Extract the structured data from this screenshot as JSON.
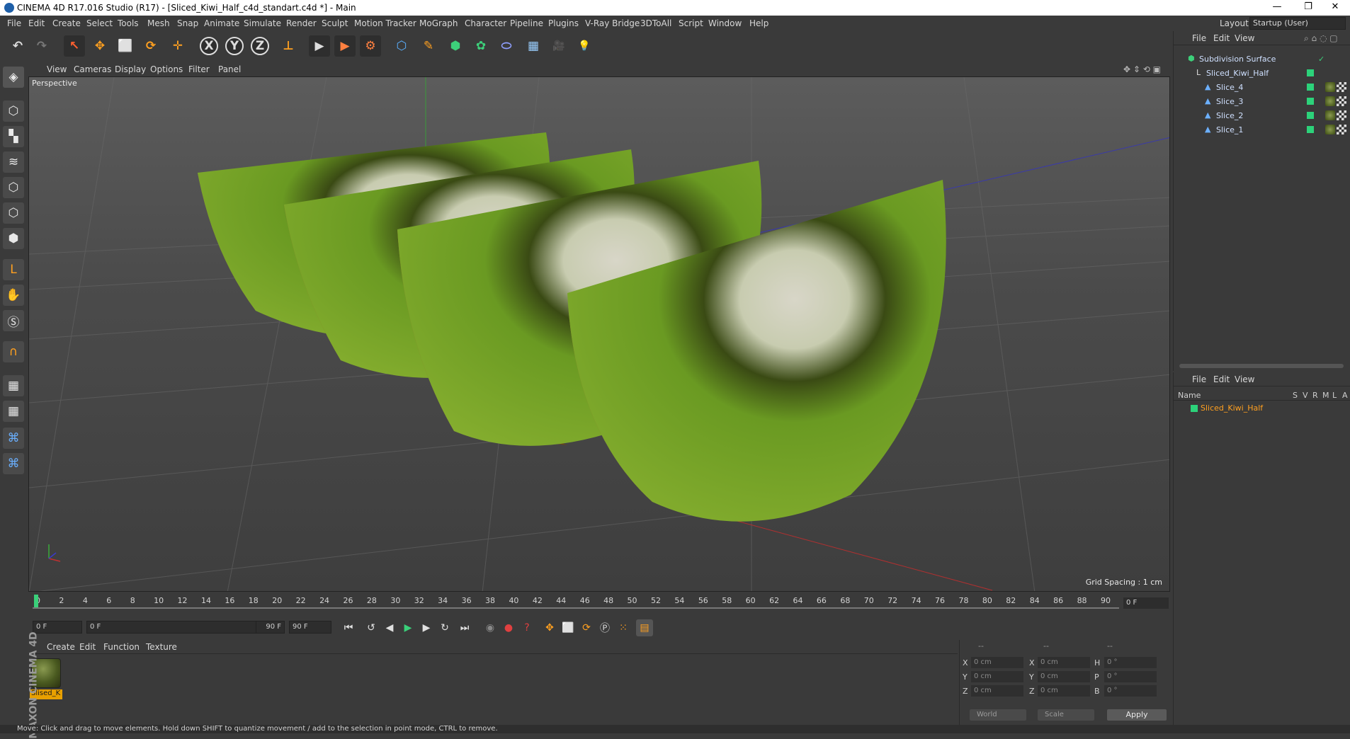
{
  "window": {
    "title": "CINEMA 4D R17.016 Studio (R17) - [Sliced_Kiwi_Half_c4d_standart.c4d *] - Main",
    "controls": [
      "—",
      "❐",
      "✕"
    ]
  },
  "menubar": {
    "items": [
      "File",
      "Edit",
      "Create",
      "Select",
      "Tools",
      "Mesh",
      "Snap",
      "Animate",
      "Simulate",
      "Render",
      "Sculpt",
      "Motion Tracker",
      "MoGraph",
      "Character",
      "Pipeline",
      "Plugins",
      "V-Ray Bridge",
      "3DToAll",
      "Script",
      "Window",
      "Help"
    ],
    "layout_label": "Layout:",
    "layout_value": "Startup (User)"
  },
  "toolbar": {
    "undo": "↶",
    "redo": "↷",
    "select": "↖",
    "move": "✥",
    "scale": "⬜",
    "rotate": "⟳",
    "add": "✛",
    "x": "X",
    "y": "Y",
    "z": "Z",
    "coord": "⊥",
    "render_view": "▶",
    "render_pic": "▶",
    "render_settings": "⚙",
    "cube": "⬡",
    "pen": "✎",
    "subdiv": "⬢",
    "array": "✿",
    "deformer": "⬭",
    "floor": "▦",
    "camera": "🎥",
    "light": "💡"
  },
  "viewport": {
    "menu": [
      "View",
      "Cameras",
      "Display",
      "Options",
      "Filter",
      "Panel"
    ],
    "label": "Perspective",
    "grid_spacing": "Grid Spacing : 1 cm"
  },
  "timeline": {
    "ticks": [
      "0",
      "2",
      "4",
      "6",
      "8",
      "10",
      "12",
      "14",
      "16",
      "18",
      "20",
      "22",
      "24",
      "26",
      "28",
      "30",
      "32",
      "34",
      "36",
      "38",
      "40",
      "42",
      "44",
      "46",
      "48",
      "50",
      "52",
      "54",
      "56",
      "58",
      "60",
      "62",
      "64",
      "66",
      "68",
      "70",
      "72",
      "74",
      "76",
      "78",
      "80",
      "82",
      "84",
      "86",
      "88",
      "90"
    ],
    "current_frame": "0 F"
  },
  "transport": {
    "start_field": "0 F",
    "range_start": "0 F",
    "range_end": "90 F",
    "end_field": "90 F"
  },
  "material_panel": {
    "menu": [
      "Create",
      "Edit",
      "Function",
      "Texture"
    ],
    "material_name": "Slised_K"
  },
  "coordinates": {
    "header": [
      "--",
      "--",
      "--"
    ],
    "rows": [
      {
        "l1": "X",
        "v1": "0 cm",
        "l2": "X",
        "v2": "0 cm",
        "l3": "H",
        "v3": "0 °"
      },
      {
        "l1": "Y",
        "v1": "0 cm",
        "l2": "Y",
        "v2": "0 cm",
        "l3": "P",
        "v3": "0 °"
      },
      {
        "l1": "Z",
        "v1": "0 cm",
        "l2": "Z",
        "v2": "0 cm",
        "l3": "B",
        "v3": "0 °"
      }
    ],
    "mode1": "World",
    "mode2": "Scale",
    "apply": "Apply"
  },
  "object_manager": {
    "menu": [
      "File",
      "Edit",
      "View"
    ],
    "objects": [
      {
        "name": "Subdivision Surface"
      },
      {
        "name": "Sliced_Kiwi_Half"
      },
      {
        "name": "Slice_4"
      },
      {
        "name": "Slice_3"
      },
      {
        "name": "Slice_2"
      },
      {
        "name": "Slice_1"
      }
    ]
  },
  "attribute_manager": {
    "menu": [
      "File",
      "Edit",
      "View"
    ],
    "columns": [
      "Name",
      "S",
      "V",
      "R",
      "M",
      "L",
      "A"
    ],
    "item": "Sliced_Kiwi_Half"
  },
  "branding": "MAXON CINEMA 4D",
  "status": "Move: Click and drag to move elements. Hold down SHIFT to quantize movement / add to the selection in point mode, CTRL to remove."
}
